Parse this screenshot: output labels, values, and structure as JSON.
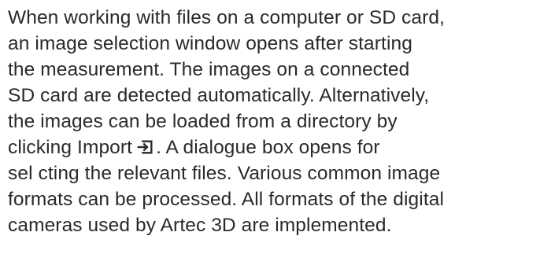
{
  "paragraph": {
    "lines": [
      "When working with files on a computer or SD card,",
      "an image selection window opens after starting",
      "the measurement. The images on a connected",
      "SD card are detected automatically. Alternatively,",
      "the images can be loaded from a directory by",
      "clicking Import",
      ". A dialogue box opens for",
      "sel cting the relevant files. Various common image",
      "formats can be processed. All formats of the digital",
      "cameras used by Artec 3D are implemented."
    ],
    "inline_icon": "import-icon"
  }
}
